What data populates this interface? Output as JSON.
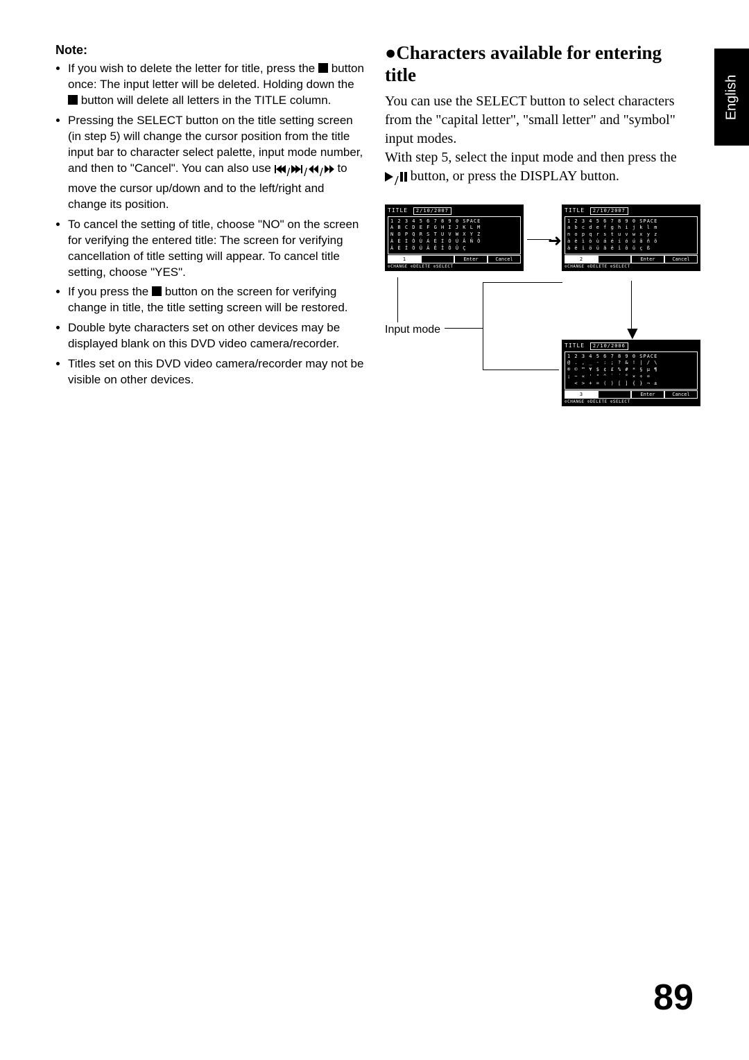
{
  "sideTab": "English",
  "pageNumber": "89",
  "leftColumn": {
    "noteHeading": "Note:",
    "bullets": [
      {
        "pre": "If you wish to delete the letter for title, press the ",
        "post": " button once: The input letter will be deleted. Holding down the ",
        "post2": " button will delete all letters in the TITLE column."
      },
      "Pressing the SELECT button on the title setting screen (in step 5) will change the cursor position from the title input bar to character select palette, input mode number, and then to \"Cancel\". You can also use ",
      " to move the cursor up/down and to the left/right and change its position.",
      "To cancel the setting of title, choose \"NO\" on the screen for verifying the entered title: The screen for verifying cancellation of title setting will appear. To cancel title setting, choose \"YES\".",
      {
        "pre": "If you press the ",
        "post": " button on the screen for verifying change in title, the title setting screen will be restored."
      },
      "Double byte characters set on other devices may be displayed blank on this DVD video camera/recorder.",
      "Titles set on this DVD video camera/recorder may not be visible on other devices."
    ]
  },
  "rightColumn": {
    "heading": "Characters available for entering title",
    "body1": "You can use the SELECT button to select characters from the \"capital letter\", \"small letter\" and \"symbol\" input modes.",
    "body2a": "With step 5, select the input mode and then press the ",
    "body2b": " button, or press the DISPLAY button.",
    "inputModeLabel": "Input mode",
    "panels": {
      "upper": {
        "title": "TITLE",
        "date": "2/10/2007",
        "rows": "1 2 3 4 5 6 7 8 9 0 SPACE\nA B C D E F G H I J K L M\nN O P Q R S T U V W X Y Z\nÀ È Ì Ò Ù Á É Í Ó Ú Â Ñ Õ\nÄ Ë Ï Ö Ü Ã Ê Î Ô Û Ç",
        "footer": [
          "1",
          "",
          "Enter",
          "Cancel"
        ],
        "help": "⊙CHANGE ⊙DELETE ⊙SELECT"
      },
      "lower": {
        "title": "TITLE",
        "date": "2/10/2007",
        "rows": "1 2 3 4 5 6 7 8 9 0 SPACE\na b c d e f g h i j k l m\nn o p q r s t u v w x y z\nà è ì ò ù á é í ó ú â ñ õ\nä ë ï ö ü ã ê î ô û ç ß",
        "footer": [
          "2",
          "",
          "Enter",
          "Cancel"
        ],
        "help": "⊙CHANGE ⊙DELETE ⊙SELECT"
      },
      "symbol": {
        "title": "TITLE",
        "date": "2/10/2006",
        "rows": "1 2 3 4 5 6 7 8 9 0 SPACE\n@ . , _ - : ; ? & ! | / \\\n® © ™ ¥ $ ¢ £ % # * § µ ¶\n¡ ~ « ' \" ^ ` ´ ° × ÷ =\n  < > + = ( ) [ ] { } ¬ ±",
        "footer": [
          "3",
          "",
          "Enter",
          "Cancel"
        ],
        "help": "⊙CHANGE ⊙DELETE ⊙SELECT"
      }
    }
  }
}
